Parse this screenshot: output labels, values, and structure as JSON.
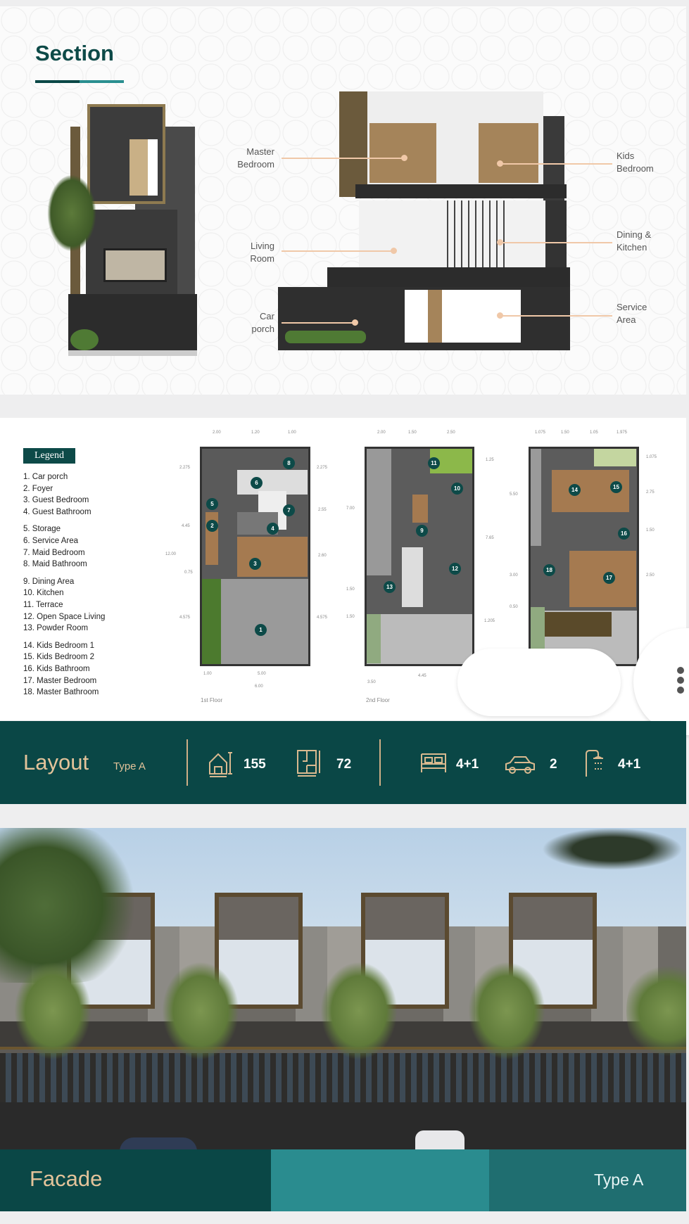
{
  "section": {
    "title": "Section",
    "labels": {
      "master_bedroom": [
        "Master",
        "Bedroom"
      ],
      "kids_bedroom": [
        "Kids",
        "Bedroom"
      ],
      "living_room": [
        "Living",
        "Room"
      ],
      "dining_kitchen": [
        "Dining &",
        "Kitchen"
      ],
      "car_porch": [
        "Car",
        "porch"
      ],
      "service_area": [
        "Service",
        "Area"
      ]
    }
  },
  "plans": {
    "legend_title": "Legend",
    "legend": [
      [
        "1. Car porch",
        "2. Foyer",
        "3. Guest Bedroom",
        "4. Guest Bathroom"
      ],
      [
        "5. Storage",
        "6. Service Area",
        "7. Maid Bedroom",
        "8. Maid Bathroom"
      ],
      [
        "9. Dining Area",
        "10. Kitchen",
        "11. Terrace",
        "12. Open Space Living",
        "13. Powder Room"
      ],
      [
        "14. Kids Bedroom 1",
        "15. Kids Bedroom 2",
        "16. Kids Bathroom",
        "17. Master Bedroom",
        "18. Master Bathroom"
      ]
    ],
    "floors": [
      {
        "label": "1st Floor",
        "rooms": [
          "1",
          "2",
          "3",
          "4",
          "5",
          "6",
          "7",
          "8"
        ],
        "dims_top": [
          "2.00",
          "1.20",
          "1.00"
        ],
        "dims_left": [
          "2.275",
          "4.45",
          "0.75",
          "4.575"
        ],
        "dims_total": "12.00",
        "dims_right": [
          "2.275",
          "2.55",
          "2.60",
          "4.575"
        ],
        "dims_bottom": [
          "1.00",
          "5.00",
          "6.00"
        ]
      },
      {
        "label": "2nd Floor",
        "rooms": [
          "9",
          "10",
          "11",
          "12",
          "13"
        ],
        "dims_top": [
          "2.00",
          "1.50",
          "2.50"
        ],
        "dims_left": [
          "7.00",
          "1.50",
          "1.50"
        ],
        "dims_right": [
          "1.25",
          "7.65",
          "1.205"
        ],
        "dims_bottom": [
          "4.45",
          "3.50"
        ]
      },
      {
        "rooms": [
          "14",
          "15",
          "16",
          "17",
          "18"
        ],
        "dims_top": [
          "1.075",
          "1.50",
          "1.05",
          "1.975"
        ],
        "dims_left": [
          "5.50",
          "3.00",
          "0.50"
        ],
        "dims_right": [
          "1.075",
          "2.75",
          "1.50",
          "2.50"
        ]
      }
    ]
  },
  "layout_bar": {
    "title": "Layout",
    "type": "Type A",
    "stats": [
      {
        "icon": "building-area-icon",
        "value": "155"
      },
      {
        "icon": "land-area-icon",
        "value": "72"
      },
      {
        "icon": "bed-icon",
        "value": "4+1"
      },
      {
        "icon": "car-icon",
        "value": "2"
      },
      {
        "icon": "shower-icon",
        "value": "4+1"
      }
    ]
  },
  "facade": {
    "title": "Facade",
    "type": "Type A"
  },
  "colors": {
    "primary": "#0a4746",
    "accent": "#d9b98f",
    "teal": "#2a8c8f",
    "label_line": "#f0c8a8"
  }
}
